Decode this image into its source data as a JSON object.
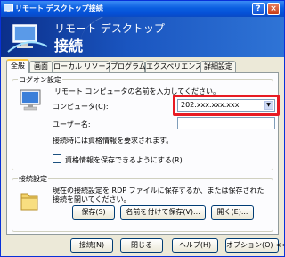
{
  "window": {
    "title": "リモート デスクトップ接続",
    "help_glyph": "?",
    "close_glyph": "×"
  },
  "banner": {
    "subtitle": "リモート デスクトップ",
    "title": "接続"
  },
  "tabs": [
    "全般",
    "画面",
    "ローカル リソース",
    "プログラム",
    "エクスペリエンス",
    "詳細設定"
  ],
  "logon": {
    "group_label": "ログオン設定",
    "instruction": "リモート コンピュータの名前を入力してください。",
    "computer_label": "コンピュータ(C):",
    "computer_value": "202.xxx.xxx.xxx",
    "username_label": "ユーザー名:",
    "username_value": "",
    "credentials_note": "接続時には資格情報を要求されます。",
    "save_credentials_label": "資格情報を保存できるようにする(R)",
    "save_credentials_checked": false
  },
  "connection_settings": {
    "group_label": "接続設定",
    "description": "現在の接続設定を RDP ファイルに保存するか、または保存された接続を開いてください。",
    "save_label": "保存(S)",
    "save_as_label": "名前を付けて保存(V)...",
    "open_label": "開く(E)..."
  },
  "footer": {
    "connect_label": "接続(N)",
    "close_label": "閉じる",
    "help_label": "ヘルプ(H)",
    "options_label": "オプション(O) <<"
  },
  "colors": {
    "title_bar": "#0a5ee0",
    "banner": "#1a55c0",
    "highlight": "#e81b23"
  }
}
